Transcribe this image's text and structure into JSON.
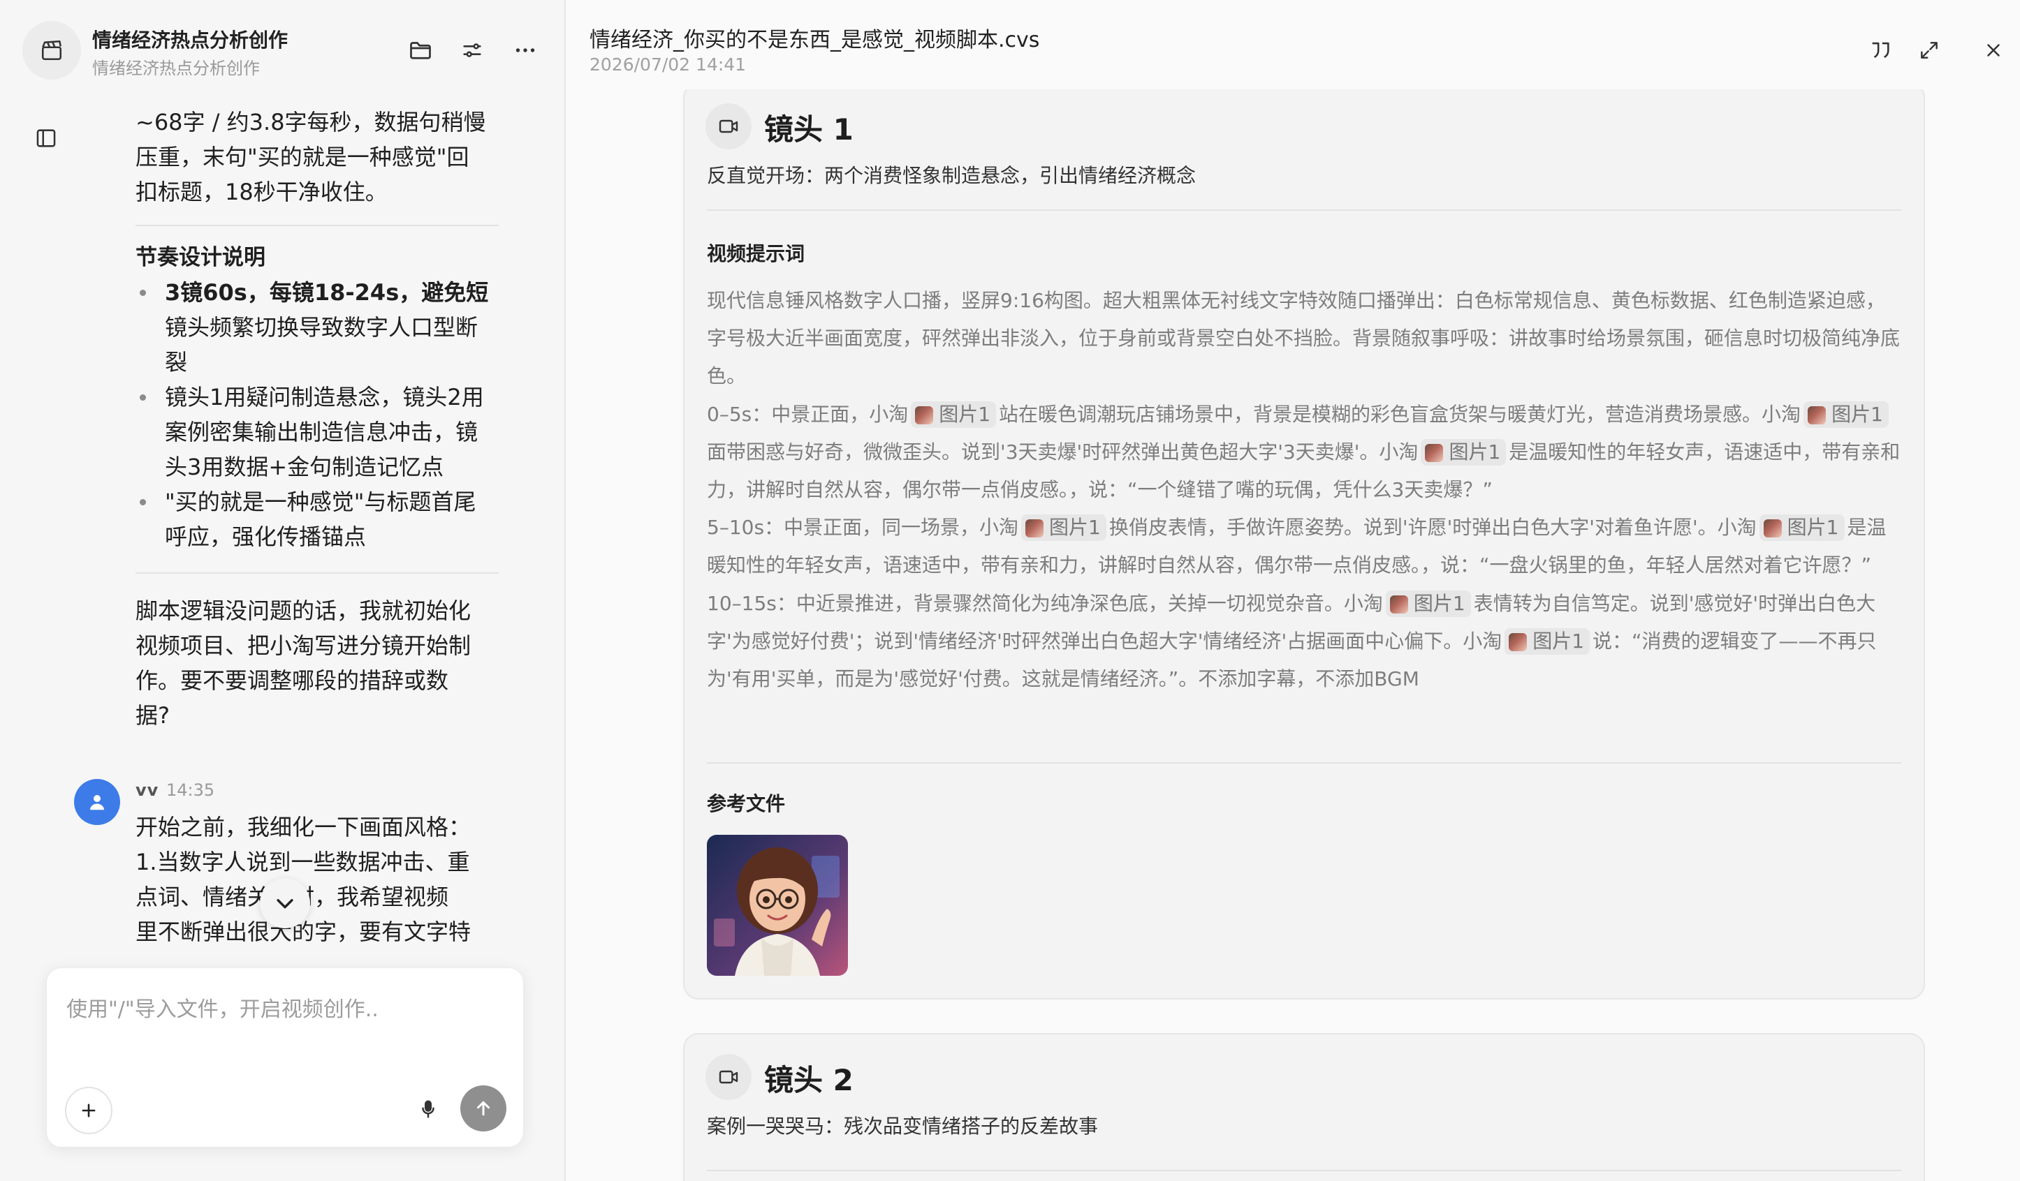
{
  "sidebar": {
    "project_title": "情绪经济热点分析创作",
    "project_subtitle": "情绪经济热点分析创作"
  },
  "chat": {
    "assistant": {
      "paragraph_1": [
        "~68字 / 约3.8字每秒，数据句稍慢",
        "压重，末句\"买的就是一种感觉\"回",
        "扣标题，18秒干净收住。"
      ],
      "rhythm_title": "节奏设计说明",
      "bullets": [
        [
          "3镜60s，每镜18-24s，避免短",
          "镜头频繁切换导致数字人口型断",
          "裂"
        ],
        [
          "镜头1用疑问制造悬念，镜头2用",
          "案例密集输出制造信息冲击，镜",
          "头3用数据+金句制造记忆点"
        ],
        [
          "\"买的就是一种感觉\"与标题首尾",
          "呼应，强化传播锚点"
        ]
      ],
      "closing": [
        "脚本逻辑没问题的话，我就初始化",
        "视频项目、把小淘写进分镜开始制",
        "作。要不要调整哪段的措辞或数",
        "据?"
      ]
    },
    "user": {
      "name": "vv",
      "time": "14:35",
      "lines": [
        "开始之前，我细化一下画面风格：",
        "1.当数字人说到一些数据冲击、重",
        "点词、情绪关键时，我希望视频",
        "里不断弹出很大的字，要有文字特"
      ]
    },
    "composer": {
      "placeholder": "使用\"/\"导入文件，开启视频创作.."
    }
  },
  "document": {
    "title": "情绪经济_你买的不是东西_是感觉_视频脚本.cvs",
    "timestamp": "2026/07/02 14:41",
    "shots": [
      {
        "title": "镜头 1",
        "description": "反直觉开场：两个消费怪象制造悬念，引出情绪经济概念",
        "prompt_label": "视频提示词",
        "chip_label": "图片1",
        "prompt_p1": "现代信息锤风格数字人口播，竖屏9:16构图。超大粗黑体无衬线文字特效随口播弹出：白色标常规信息、黄色标数据、红色制造紧迫感，字号极大近半画面宽度，砰然弹出非淡入，位于身前或背景空白处不挡脸。背景随叙事呼吸：讲故事时给场景氛围，砸信息时切极简纯净底色。",
        "prompt_p2": [
          "0–5s：中景正面，小淘",
          "站在暖色调潮玩店铺场景中，背景是模糊的彩色盲盒货架与暖黄灯光，营造消费场景感。小淘",
          "面带困惑与好奇，微微歪头。说到'3天卖爆'时砰然弹出黄色超大字'3天卖爆'。小淘",
          "是温暖知性的年轻女声，语速适中，带有亲和力，讲解时自然从容，偶尔带一点俏皮感。，说：“一个缝错了嘴的玩偶，凭什么3天卖爆？”"
        ],
        "prompt_p3": [
          "5–10s：中景正面，同一场景，小淘",
          "换俏皮表情，手做许愿姿势。说到'许愿'时弹出白色大字'对着鱼许愿'。小淘",
          "是温暖知性的年轻女声，语速适中，带有亲和力，讲解时自然从容，偶尔带一点俏皮感。，说：“一盘火锅里的鱼，年轻人居然对着它许愿？”"
        ],
        "prompt_p4": [
          "10–15s：中近景推进，背景骤然简化为纯净深色底，关掉一切视觉杂音。小淘",
          "表情转为自信笃定。说到'感觉好'时弹出白色大字'为感觉好付费'；说到'情绪经济'时砰然弹出白色超大字'情绪经济'占据画面中心偏下。小淘",
          "说：“消费的逻辑变了——不再只为'有用'买单，而是为'感觉好'付费。这就是情绪经济。”。不添加字幕，不添加BGM"
        ],
        "reference_label": "参考文件"
      },
      {
        "title": "镜头 2",
        "description": "案例一哭哭马：残次品变情绪搭子的反差故事"
      }
    ]
  },
  "colors": {
    "accent_user": "#3d7be8",
    "send_button": "#8f8f8f",
    "card_bg": "#f3f3f3"
  }
}
